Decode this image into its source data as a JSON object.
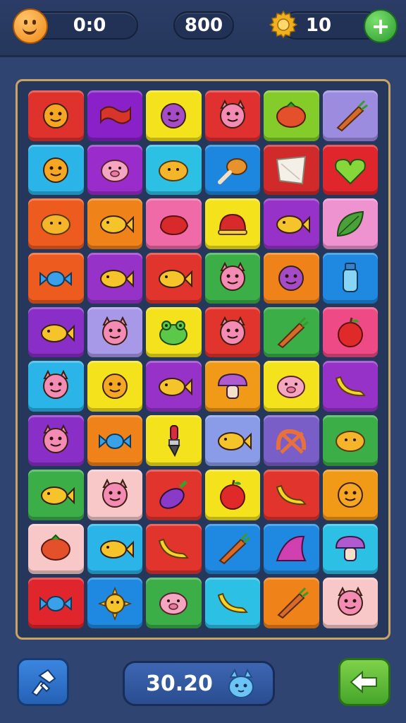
{
  "hud": {
    "score_display": "0:0",
    "center_value": "800",
    "gear_count": "10"
  },
  "footer": {
    "timer": "30.20"
  },
  "grid": [
    {
      "color": "#e0322c",
      "icon": "face"
    },
    {
      "color": "#8a20c8",
      "icon": "bacon"
    },
    {
      "color": "#f4e31c",
      "icon": "blob"
    },
    {
      "color": "#e03030",
      "icon": "cat"
    },
    {
      "color": "#83cc2a",
      "icon": "berry"
    },
    {
      "color": "#9b8ce0",
      "icon": "carrot"
    },
    {
      "color": "#2ab4e8",
      "icon": "face"
    },
    {
      "color": "#9a2ccc",
      "icon": "pig"
    },
    {
      "color": "#2cc0e4",
      "icon": "lemon"
    },
    {
      "color": "#1d86de",
      "icon": "drumstick"
    },
    {
      "color": "#d02a2a",
      "icon": "napkin"
    },
    {
      "color": "#e0262c",
      "icon": "heart"
    },
    {
      "color": "#ee5b1e",
      "icon": "lemon"
    },
    {
      "color": "#f0821a",
      "icon": "fish"
    },
    {
      "color": "#ef6aa6",
      "icon": "meat"
    },
    {
      "color": "#f4e31c",
      "icon": "cake"
    },
    {
      "color": "#9632c8",
      "icon": "fish"
    },
    {
      "color": "#ee92d0",
      "icon": "leaf"
    },
    {
      "color": "#ee5b1e",
      "icon": "candy"
    },
    {
      "color": "#9632c8",
      "icon": "fish"
    },
    {
      "color": "#e0342c",
      "icon": "fish"
    },
    {
      "color": "#3cae48",
      "icon": "cat"
    },
    {
      "color": "#f0821a",
      "icon": "blob"
    },
    {
      "color": "#1f88e0",
      "icon": "bottle"
    },
    {
      "color": "#8a2ec8",
      "icon": "fish"
    },
    {
      "color": "#a898e8",
      "icon": "cat"
    },
    {
      "color": "#f4e31c",
      "icon": "frog"
    },
    {
      "color": "#e0342c",
      "icon": "cat"
    },
    {
      "color": "#3cae48",
      "icon": "carrot"
    },
    {
      "color": "#ee4a86",
      "icon": "apple"
    },
    {
      "color": "#2ab4e8",
      "icon": "cat"
    },
    {
      "color": "#f4e31c",
      "icon": "face"
    },
    {
      "color": "#9632c8",
      "icon": "fish"
    },
    {
      "color": "#f09a18",
      "icon": "mushroom"
    },
    {
      "color": "#f4e31c",
      "icon": "pig"
    },
    {
      "color": "#9632c8",
      "icon": "banana"
    },
    {
      "color": "#8a2ec8",
      "icon": "cat"
    },
    {
      "color": "#f0821a",
      "icon": "candy"
    },
    {
      "color": "#f4e31c",
      "icon": "brush"
    },
    {
      "color": "#8a9ce8",
      "icon": "fish"
    },
    {
      "color": "#7a5ec8",
      "icon": "pretzel"
    },
    {
      "color": "#3cae48",
      "icon": "lemon"
    },
    {
      "color": "#3cae48",
      "icon": "fish"
    },
    {
      "color": "#f8c8c8",
      "icon": "cat"
    },
    {
      "color": "#e0342c",
      "icon": "eggplant"
    },
    {
      "color": "#f4e31c",
      "icon": "apple"
    },
    {
      "color": "#e0342c",
      "icon": "banana"
    },
    {
      "color": "#f09a18",
      "icon": "face"
    },
    {
      "color": "#f8c8c8",
      "icon": "berry"
    },
    {
      "color": "#2ab4e8",
      "icon": "fish"
    },
    {
      "color": "#e0342c",
      "icon": "banana"
    },
    {
      "color": "#1f88e0",
      "icon": "carrot"
    },
    {
      "color": "#1f88e0",
      "icon": "fin"
    },
    {
      "color": "#2cc0e4",
      "icon": "mushroom"
    },
    {
      "color": "#e0262c",
      "icon": "candy"
    },
    {
      "color": "#1f88e0",
      "icon": "sun"
    },
    {
      "color": "#3cae48",
      "icon": "pig"
    },
    {
      "color": "#2cc0e4",
      "icon": "banana"
    },
    {
      "color": "#f0821a",
      "icon": "carrot"
    },
    {
      "color": "#f8c8c8",
      "icon": "cat"
    }
  ],
  "icon_colors": {
    "face": "#f5a623",
    "bacon": "#d7352a",
    "blob": "#a64bc8",
    "cat": "#f38bb5",
    "berry": "#e4502a",
    "carrot": "#d66a2a",
    "pig": "#f4a6c0",
    "lemon": "#f5b52a",
    "drumstick": "#e8922e",
    "napkin": "#f4f0e8",
    "heart": "#86d83a",
    "fish": "#f5c42a",
    "meat": "#d82a2a",
    "cake": "#d82a2a",
    "leaf": "#4aa03a",
    "candy": "#3aa0e8",
    "bottle": "#88d4f4",
    "frog": "#5cc84a",
    "apple": "#e02a2a",
    "mushroom": "#b05ad0",
    "banana": "#f5d42a",
    "brush": "#d82a40",
    "pretzel": "#e8703a",
    "eggplant": "#8a3ac8",
    "fin": "#d040b0",
    "sun": "#f5c42a"
  }
}
